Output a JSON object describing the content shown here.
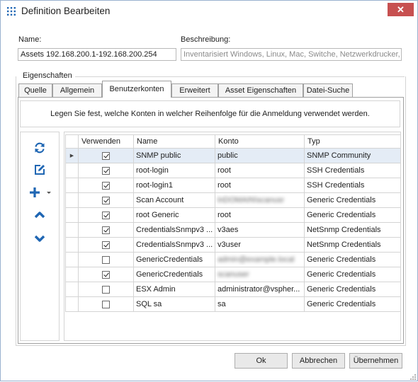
{
  "window": {
    "title": "Definition Bearbeiten",
    "close_glyph": "✕",
    "accent": "#c75050"
  },
  "form": {
    "name_label": "Name:",
    "name_value": "Assets 192.168.200.1-192.168.200.254",
    "description_label": "Beschreibung:",
    "description_placeholder": "Inventarisiert Windows, Linux, Mac, Switche, Netzwerkdrucker,"
  },
  "properties_label": "Eigenschaften",
  "tabs": [
    {
      "label": "Quelle",
      "active": false
    },
    {
      "label": "Allgemein",
      "active": false
    },
    {
      "label": "Benutzerkonten",
      "active": true
    },
    {
      "label": "Erweitert",
      "active": false
    },
    {
      "label": "Asset Eigenschaften",
      "active": false
    },
    {
      "label": "Datei-Suche",
      "active": false
    }
  ],
  "info_text": "Legen Sie fest, welche Konten in welcher Reihenfolge für die Anmeldung verwendet werden.",
  "toolbar": [
    {
      "icon": "refresh-icon"
    },
    {
      "icon": "edit-icon"
    },
    {
      "icon": "add-icon",
      "dropdown": true
    },
    {
      "icon": "move-up-icon"
    },
    {
      "icon": "move-down-icon"
    }
  ],
  "grid": {
    "columns": [
      "Verwenden",
      "Name",
      "Konto",
      "Typ"
    ],
    "rows": [
      {
        "use": true,
        "name": "SNMP public",
        "account": "public",
        "type": "SNMP Community",
        "selected": true,
        "blurred": false
      },
      {
        "use": true,
        "name": "root-login",
        "account": "root",
        "type": "SSH Credentials",
        "selected": false,
        "blurred": false
      },
      {
        "use": true,
        "name": "root-login1",
        "account": "root",
        "type": "SSH Credentials",
        "selected": false,
        "blurred": false
      },
      {
        "use": true,
        "name": "Scan Account",
        "account": "lnDOMAIN\\scanusr",
        "type": "Generic Credentials",
        "selected": false,
        "blurred": true
      },
      {
        "use": true,
        "name": "root Generic",
        "account": "root",
        "type": "Generic Credentials",
        "selected": false,
        "blurred": false
      },
      {
        "use": true,
        "name": "CredentialsSnmpv3 ...",
        "account": "v3aes",
        "type": "NetSnmp Credentials",
        "selected": false,
        "blurred": false
      },
      {
        "use": true,
        "name": "CredentialsSnmpv3 ...",
        "account": "v3user",
        "type": "NetSnmp Credentials",
        "selected": false,
        "blurred": false
      },
      {
        "use": false,
        "name": "GenericCredentials",
        "account": "admin@example.local",
        "type": "Generic Credentials",
        "selected": false,
        "blurred": true
      },
      {
        "use": true,
        "name": "GenericCredentials",
        "account": "scanuser",
        "type": "Generic Credentials",
        "selected": false,
        "blurred": true
      },
      {
        "use": false,
        "name": "ESX Admin",
        "account": "administrator@vspher...",
        "type": "Generic Credentials",
        "selected": false,
        "blurred": false
      },
      {
        "use": false,
        "name": "SQL sa",
        "account": "sa",
        "type": "Generic Credentials",
        "selected": false,
        "blurred": false
      }
    ]
  },
  "buttons": {
    "ok": "Ok",
    "cancel": "Abbrechen",
    "apply": "Übernehmen"
  }
}
